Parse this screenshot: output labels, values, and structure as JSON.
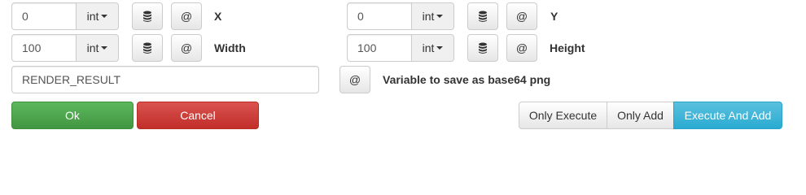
{
  "fields": {
    "x": {
      "value": "0",
      "type": "int",
      "label": "X"
    },
    "y": {
      "value": "0",
      "type": "int",
      "label": "Y"
    },
    "width": {
      "value": "100",
      "type": "int",
      "label": "Width"
    },
    "height": {
      "value": "100",
      "type": "int",
      "label": "Height"
    }
  },
  "result": {
    "value": "RENDER_RESULT",
    "label": "Variable to save as base64 png"
  },
  "icons": {
    "variable": "@",
    "database": "database-icon"
  },
  "actions": {
    "ok": "Ok",
    "cancel": "Cancel"
  },
  "mode_group": {
    "only_execute": "Only Execute",
    "only_add": "Only Add",
    "execute_and_add": "Execute And Add"
  },
  "colors": {
    "ok": "#5cb85c",
    "cancel": "#d9534f",
    "info": "#5bc0de"
  }
}
